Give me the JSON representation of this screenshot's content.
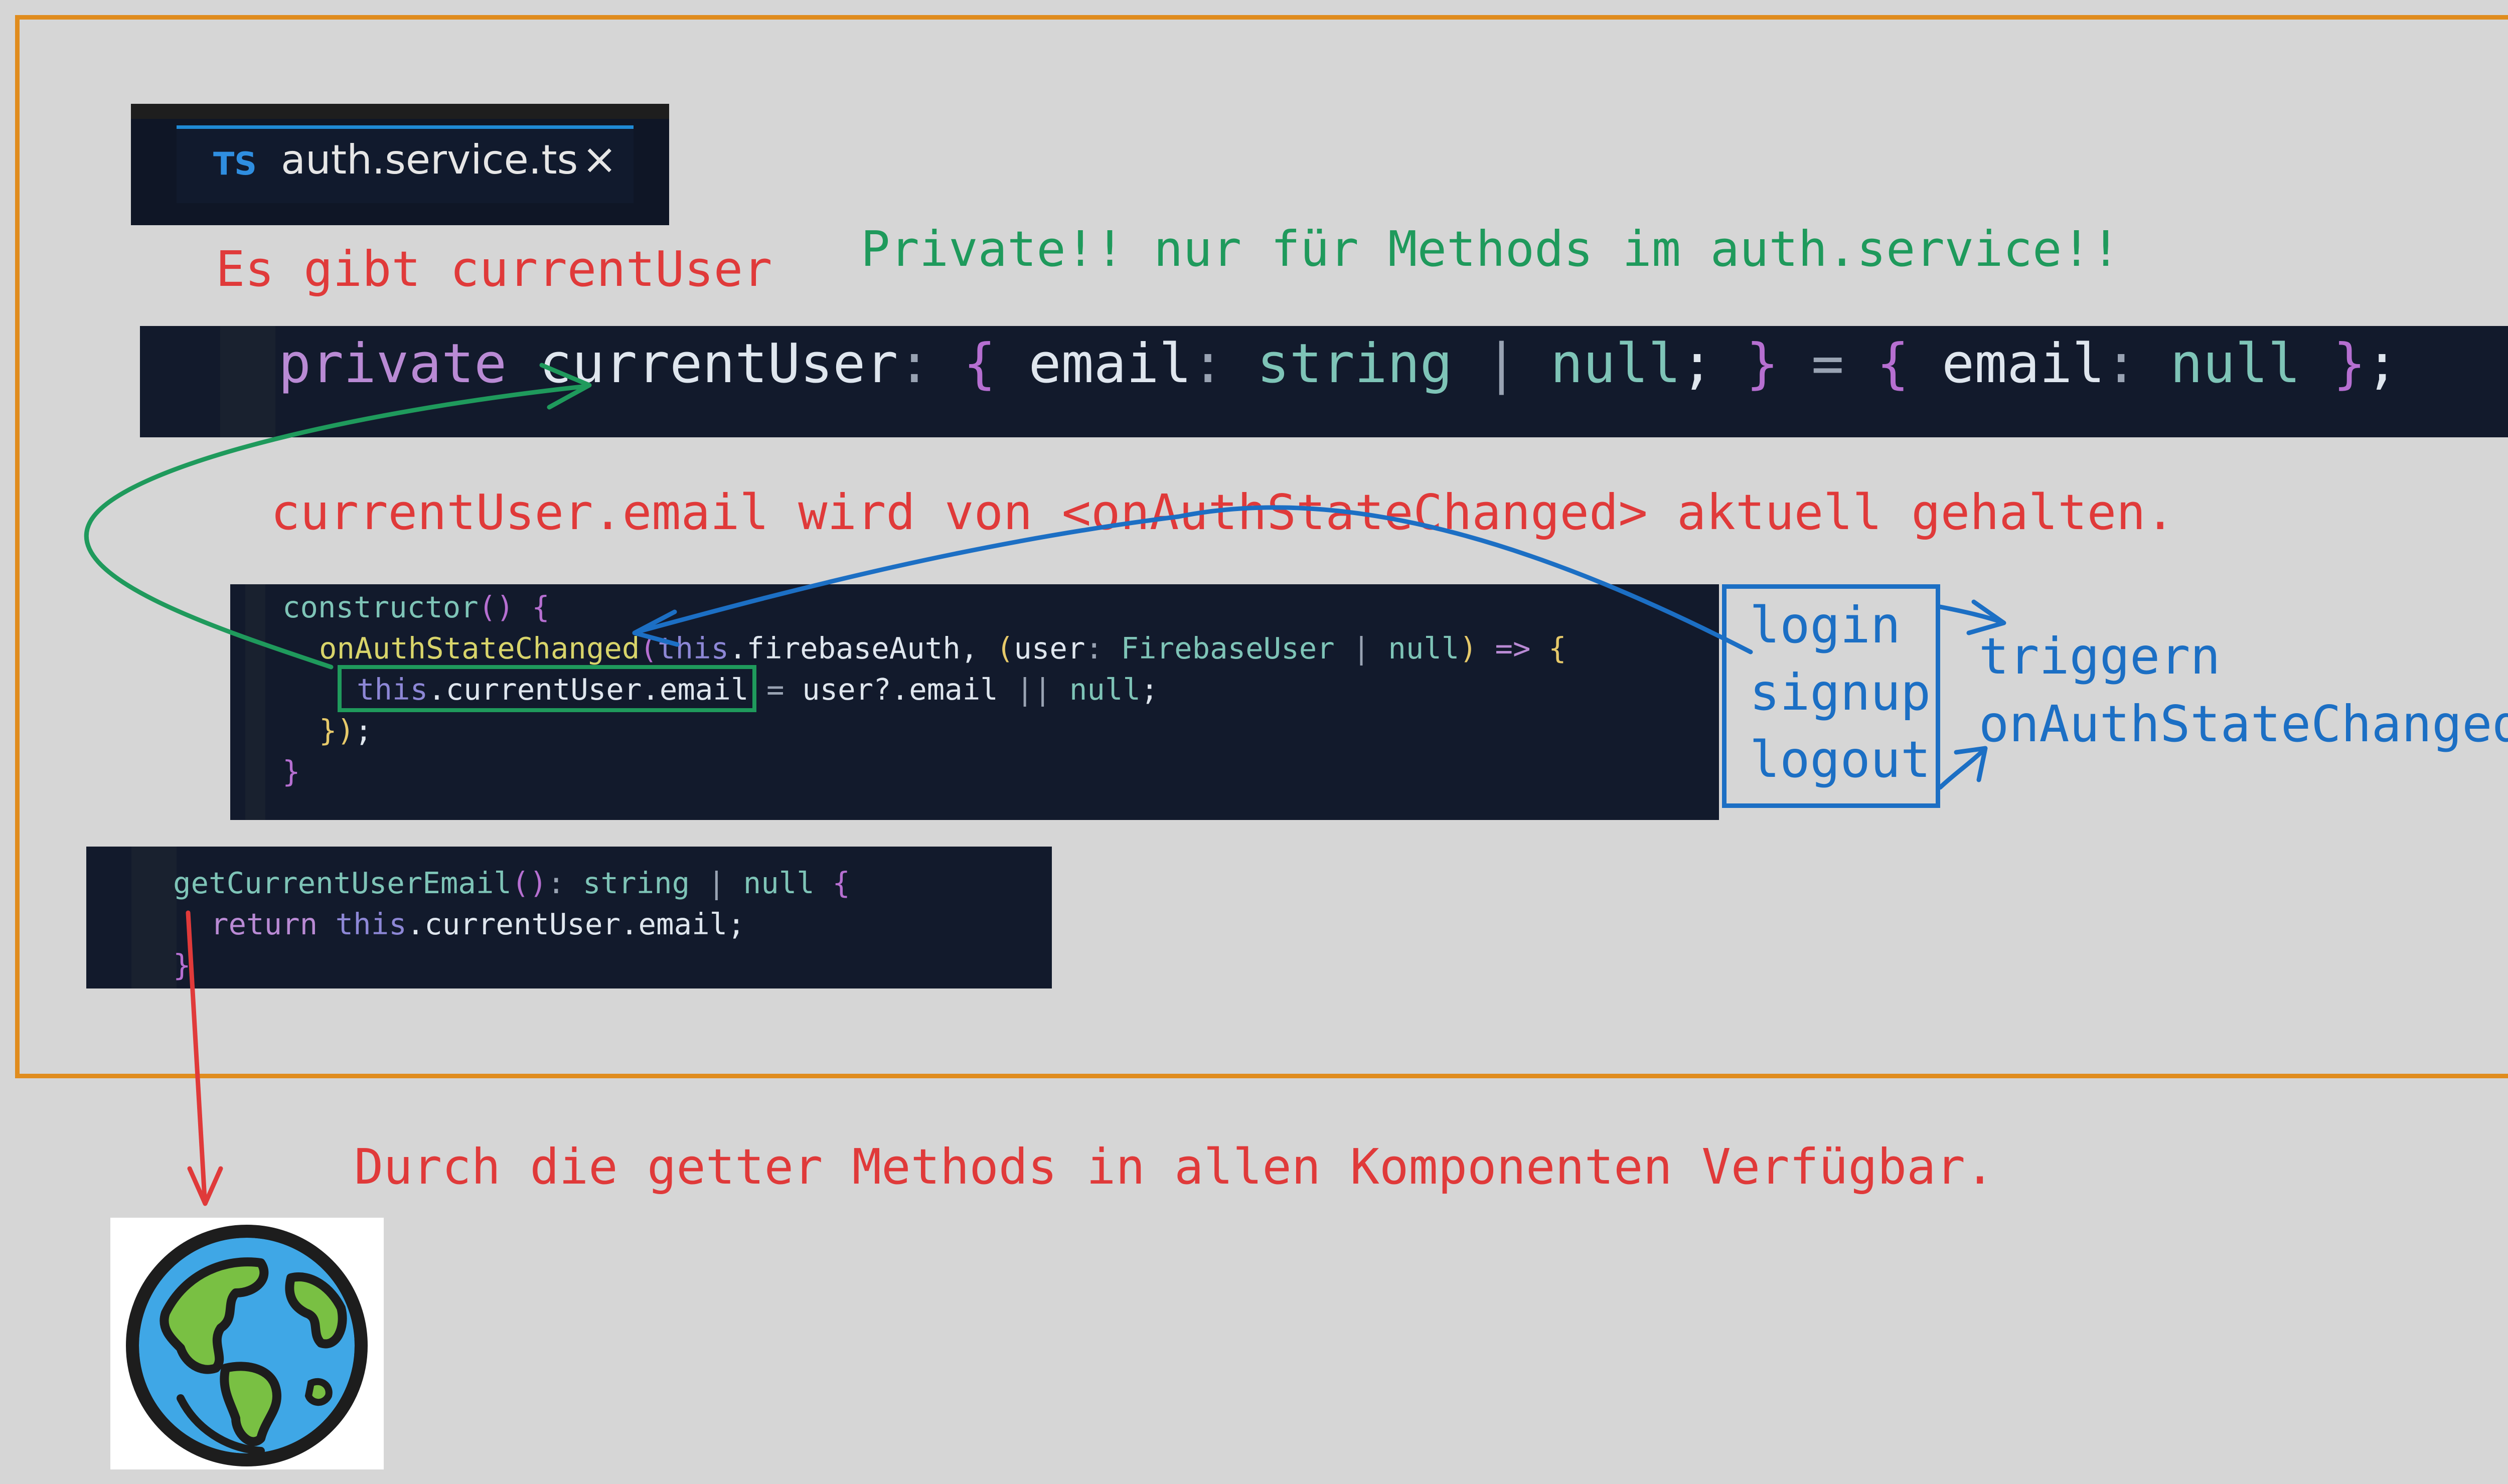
{
  "tab": {
    "language_badge": "TS",
    "file_name": "auth.service.ts",
    "close_glyph": "×"
  },
  "code_field": {
    "tokens": [
      "private",
      " currentUser",
      ":",
      " {",
      " email",
      ":",
      " string",
      " |",
      " null",
      ";",
      " }",
      " =",
      " {",
      " email",
      ":",
      " null",
      " }",
      ";"
    ]
  },
  "code_constructor": {
    "line1": [
      "constructor",
      "()",
      " {"
    ],
    "line2": [
      "onAuthStateChanged",
      "(",
      "this",
      ".firebaseAuth, ",
      "(",
      "user",
      ": ",
      "FirebaseUser",
      " | ",
      "null",
      ")",
      " => ",
      "{"
    ],
    "line3": [
      "this",
      ".currentUser.email",
      " = ",
      "user?.email",
      " || ",
      "null",
      ";"
    ],
    "line4": [
      "})",
      ";"
    ],
    "line5": [
      "}"
    ]
  },
  "code_getter": {
    "line1": [
      "getCurrentUserEmail",
      "()",
      ": ",
      "string",
      " | ",
      "null",
      " {"
    ],
    "line2": [
      "return",
      " this",
      ".currentUser.email;"
    ],
    "line3": [
      "}"
    ]
  },
  "annotations": {
    "es_gibt": "Es gibt currentUser",
    "private_note": "Private!! nur für Methods im auth.service!!",
    "aktuell": "currentUser.email wird von <onAuthStateChanged> aktuell gehalten.",
    "getter_note": "Durch die getter Methods in allen Komponenten Verfügbar.",
    "actions": [
      "login",
      "signup",
      "logout"
    ],
    "trigger_1": "triggern",
    "trigger_2": "onAuthStateChanged()"
  },
  "icons": {
    "globe": "globe-icon"
  },
  "colors": {
    "frame": "#e08c1e",
    "red": "#e03a3a",
    "green": "#1f9a5c",
    "blue": "#1c6fc4",
    "code_bg": "#121a2c"
  }
}
